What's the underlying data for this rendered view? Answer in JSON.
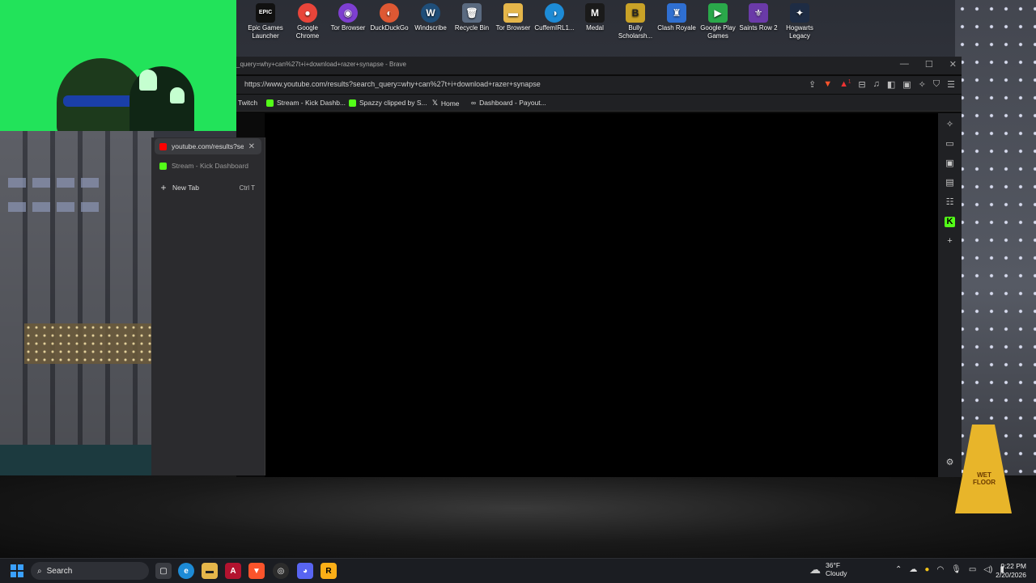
{
  "desktop": {
    "icons": [
      {
        "label": "Epic Games Launcher",
        "glyph": "EPIC",
        "color": "#111111",
        "icon": "epic-games-icon"
      },
      {
        "label": "Google Chrome",
        "glyph": "●",
        "color": "#e9453a",
        "icon": "chrome-icon"
      },
      {
        "label": "Tor Browser",
        "glyph": "◉",
        "color": "#7e3fd1",
        "icon": "tor-icon"
      },
      {
        "label": "DuckDuckGo",
        "glyph": "◐",
        "color": "#de5833",
        "icon": "duckduckgo-icon"
      },
      {
        "label": "Windscribe",
        "glyph": "W",
        "color": "#1f4e79",
        "icon": "windscribe-icon"
      },
      {
        "label": "Recycle Bin",
        "glyph": "🗑",
        "color": "#5a6a80",
        "icon": "recycle-bin-icon"
      },
      {
        "label": "Tor Browser",
        "glyph": "▬",
        "color": "#e5b64a",
        "icon": "folder-icon"
      },
      {
        "label": "CuffemIRL1...",
        "glyph": "◑",
        "color": "#1d8bd6",
        "icon": "edge-icon"
      },
      {
        "label": "Medal",
        "glyph": "M",
        "color": "#1a1a1a",
        "icon": "medal-icon"
      },
      {
        "label": "Bully Scholarsh...",
        "glyph": "B",
        "color": "#c9a227",
        "icon": "bully-icon"
      },
      {
        "label": "Clash Royale",
        "glyph": "♜",
        "color": "#2f6fd1",
        "icon": "clash-royale-icon"
      },
      {
        "label": "Google Play Games",
        "glyph": "▶",
        "color": "#2aa84a",
        "icon": "google-play-games-icon"
      },
      {
        "label": "Saints Row 2",
        "glyph": "⚜",
        "color": "#6a3aa8",
        "icon": "saints-row-icon"
      },
      {
        "label": "Hogwarts Legacy",
        "glyph": "✦",
        "color": "#1e2c44",
        "icon": "hogwarts-icon"
      }
    ]
  },
  "browser": {
    "window_title": "_query=why+can%27t+i+download+razer+synapse - Brave",
    "url": "https://www.youtube.com/results?search_query=why+can%27t+i+download+razer+synapse",
    "window_controls": {
      "minimize": "—",
      "maximize": "☐",
      "close": "✕"
    },
    "bookmarks": [
      {
        "label": "Twitch",
        "color": "#9146ff"
      },
      {
        "label": "Stream - Kick Dashb...",
        "color": "#53fc18"
      },
      {
        "label": "Spazzy clipped by S...",
        "color": "#53fc18"
      },
      {
        "label": "Home",
        "color": "#ffffff"
      },
      {
        "label": "Dashboard - Payout...",
        "color": "#aaaaaa"
      }
    ],
    "toolbar_badge": "1"
  },
  "tab_panel": {
    "tabs": [
      {
        "label": "youtube.com/results?search_query=why",
        "color": "#ff0000",
        "active": true
      },
      {
        "label": "Stream - Kick Dashboard",
        "color": "#53fc18",
        "active": false
      }
    ],
    "new_tab": {
      "label": "New Tab",
      "shortcut": "Ctrl   T"
    }
  },
  "taskbar": {
    "search_label": "Search",
    "weather": {
      "temp": "36°F",
      "condition": "Cloudy",
      "badge": "5"
    },
    "time": "9:22 PM",
    "date": "2/20/2026"
  },
  "wallpaper": {
    "sign_text": "WET FLOOR"
  }
}
